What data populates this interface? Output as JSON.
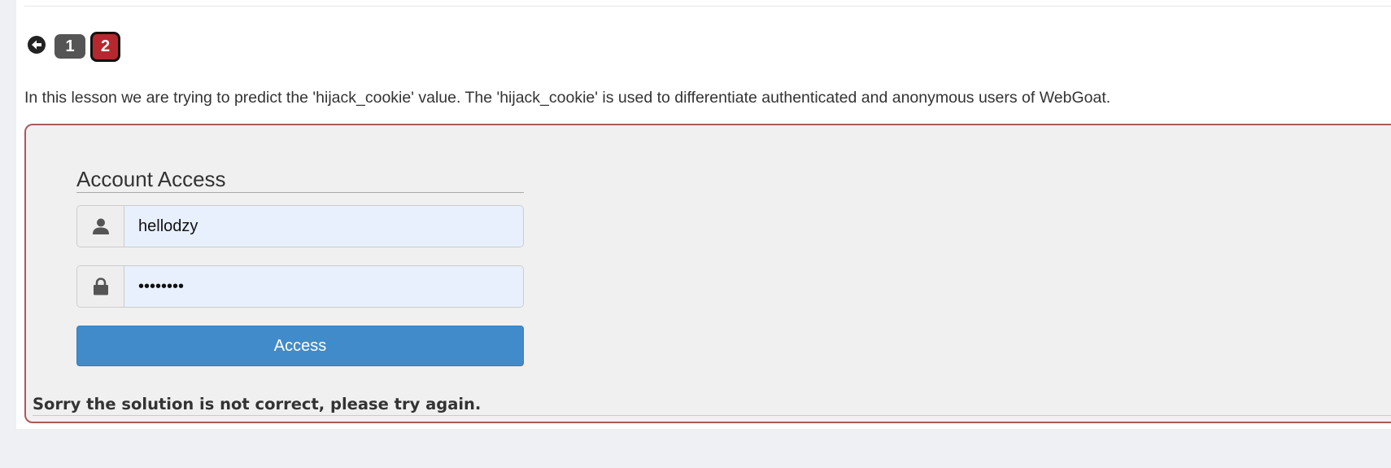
{
  "navigation": {
    "back_icon": "arrow-left-circle-icon",
    "pages": [
      {
        "label": "1",
        "active": false
      },
      {
        "label": "2",
        "active": true
      }
    ]
  },
  "lesson": {
    "intro": "In this lesson we are trying to predict the 'hijack_cookie' value. The 'hijack_cookie' is used to differentiate authenticated and anonymous users of WebGoat."
  },
  "form": {
    "title": "Account Access",
    "username": {
      "icon": "user-icon",
      "value": "hellodzy"
    },
    "password": {
      "icon": "lock-icon",
      "value": "password"
    },
    "submit_label": "Access",
    "feedback": "Sorry the solution is not correct, please try again."
  },
  "colors": {
    "page_background": "#eff0f4",
    "container_background": "#f0f0f0",
    "container_border": "#a85a5e",
    "active_page": "#b7282e",
    "inactive_page": "#555555",
    "primary_button": "#428bca",
    "autofill_field": "#e8f0fe"
  }
}
